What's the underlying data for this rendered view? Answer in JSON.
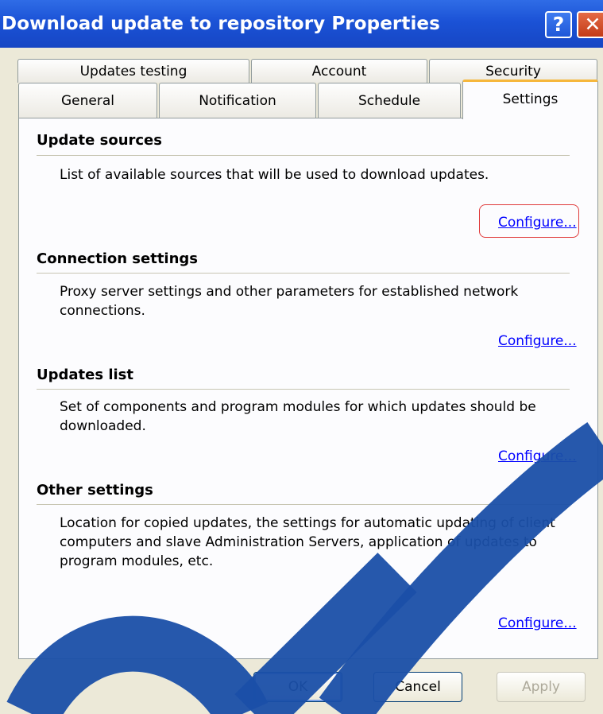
{
  "window": {
    "title": "Download update to repository Properties",
    "help_button": "?",
    "close_button": "✕"
  },
  "tabs": {
    "row1": [
      "Updates testing",
      "Account",
      "Security"
    ],
    "row2": [
      "General",
      "Notification",
      "Schedule",
      "Settings"
    ],
    "active": "Settings"
  },
  "sections": [
    {
      "title": "Update sources",
      "description": "List of available sources that will be used to download updates.",
      "link": "Configure..."
    },
    {
      "title": "Connection settings",
      "description": "Proxy server settings and other parameters for established network connections.",
      "link": "Configure..."
    },
    {
      "title": "Updates list",
      "description": "Set of components and program modules for which updates should be downloaded.",
      "link": "Configure..."
    },
    {
      "title": "Other settings",
      "description": "Location for copied updates, the settings for automatic updating of client computers and slave Administration Servers, application of updates to program modules, etc.",
      "link": "Configure..."
    }
  ],
  "buttons": {
    "ok": "OK",
    "cancel": "Cancel",
    "apply": "Apply"
  },
  "colors": {
    "titlebar": "#1b52d6",
    "link": "#0000ff",
    "active_tab_accent": "#f6b73c",
    "highlight": "#e03a3a",
    "watermark": "#1a4fa8"
  }
}
